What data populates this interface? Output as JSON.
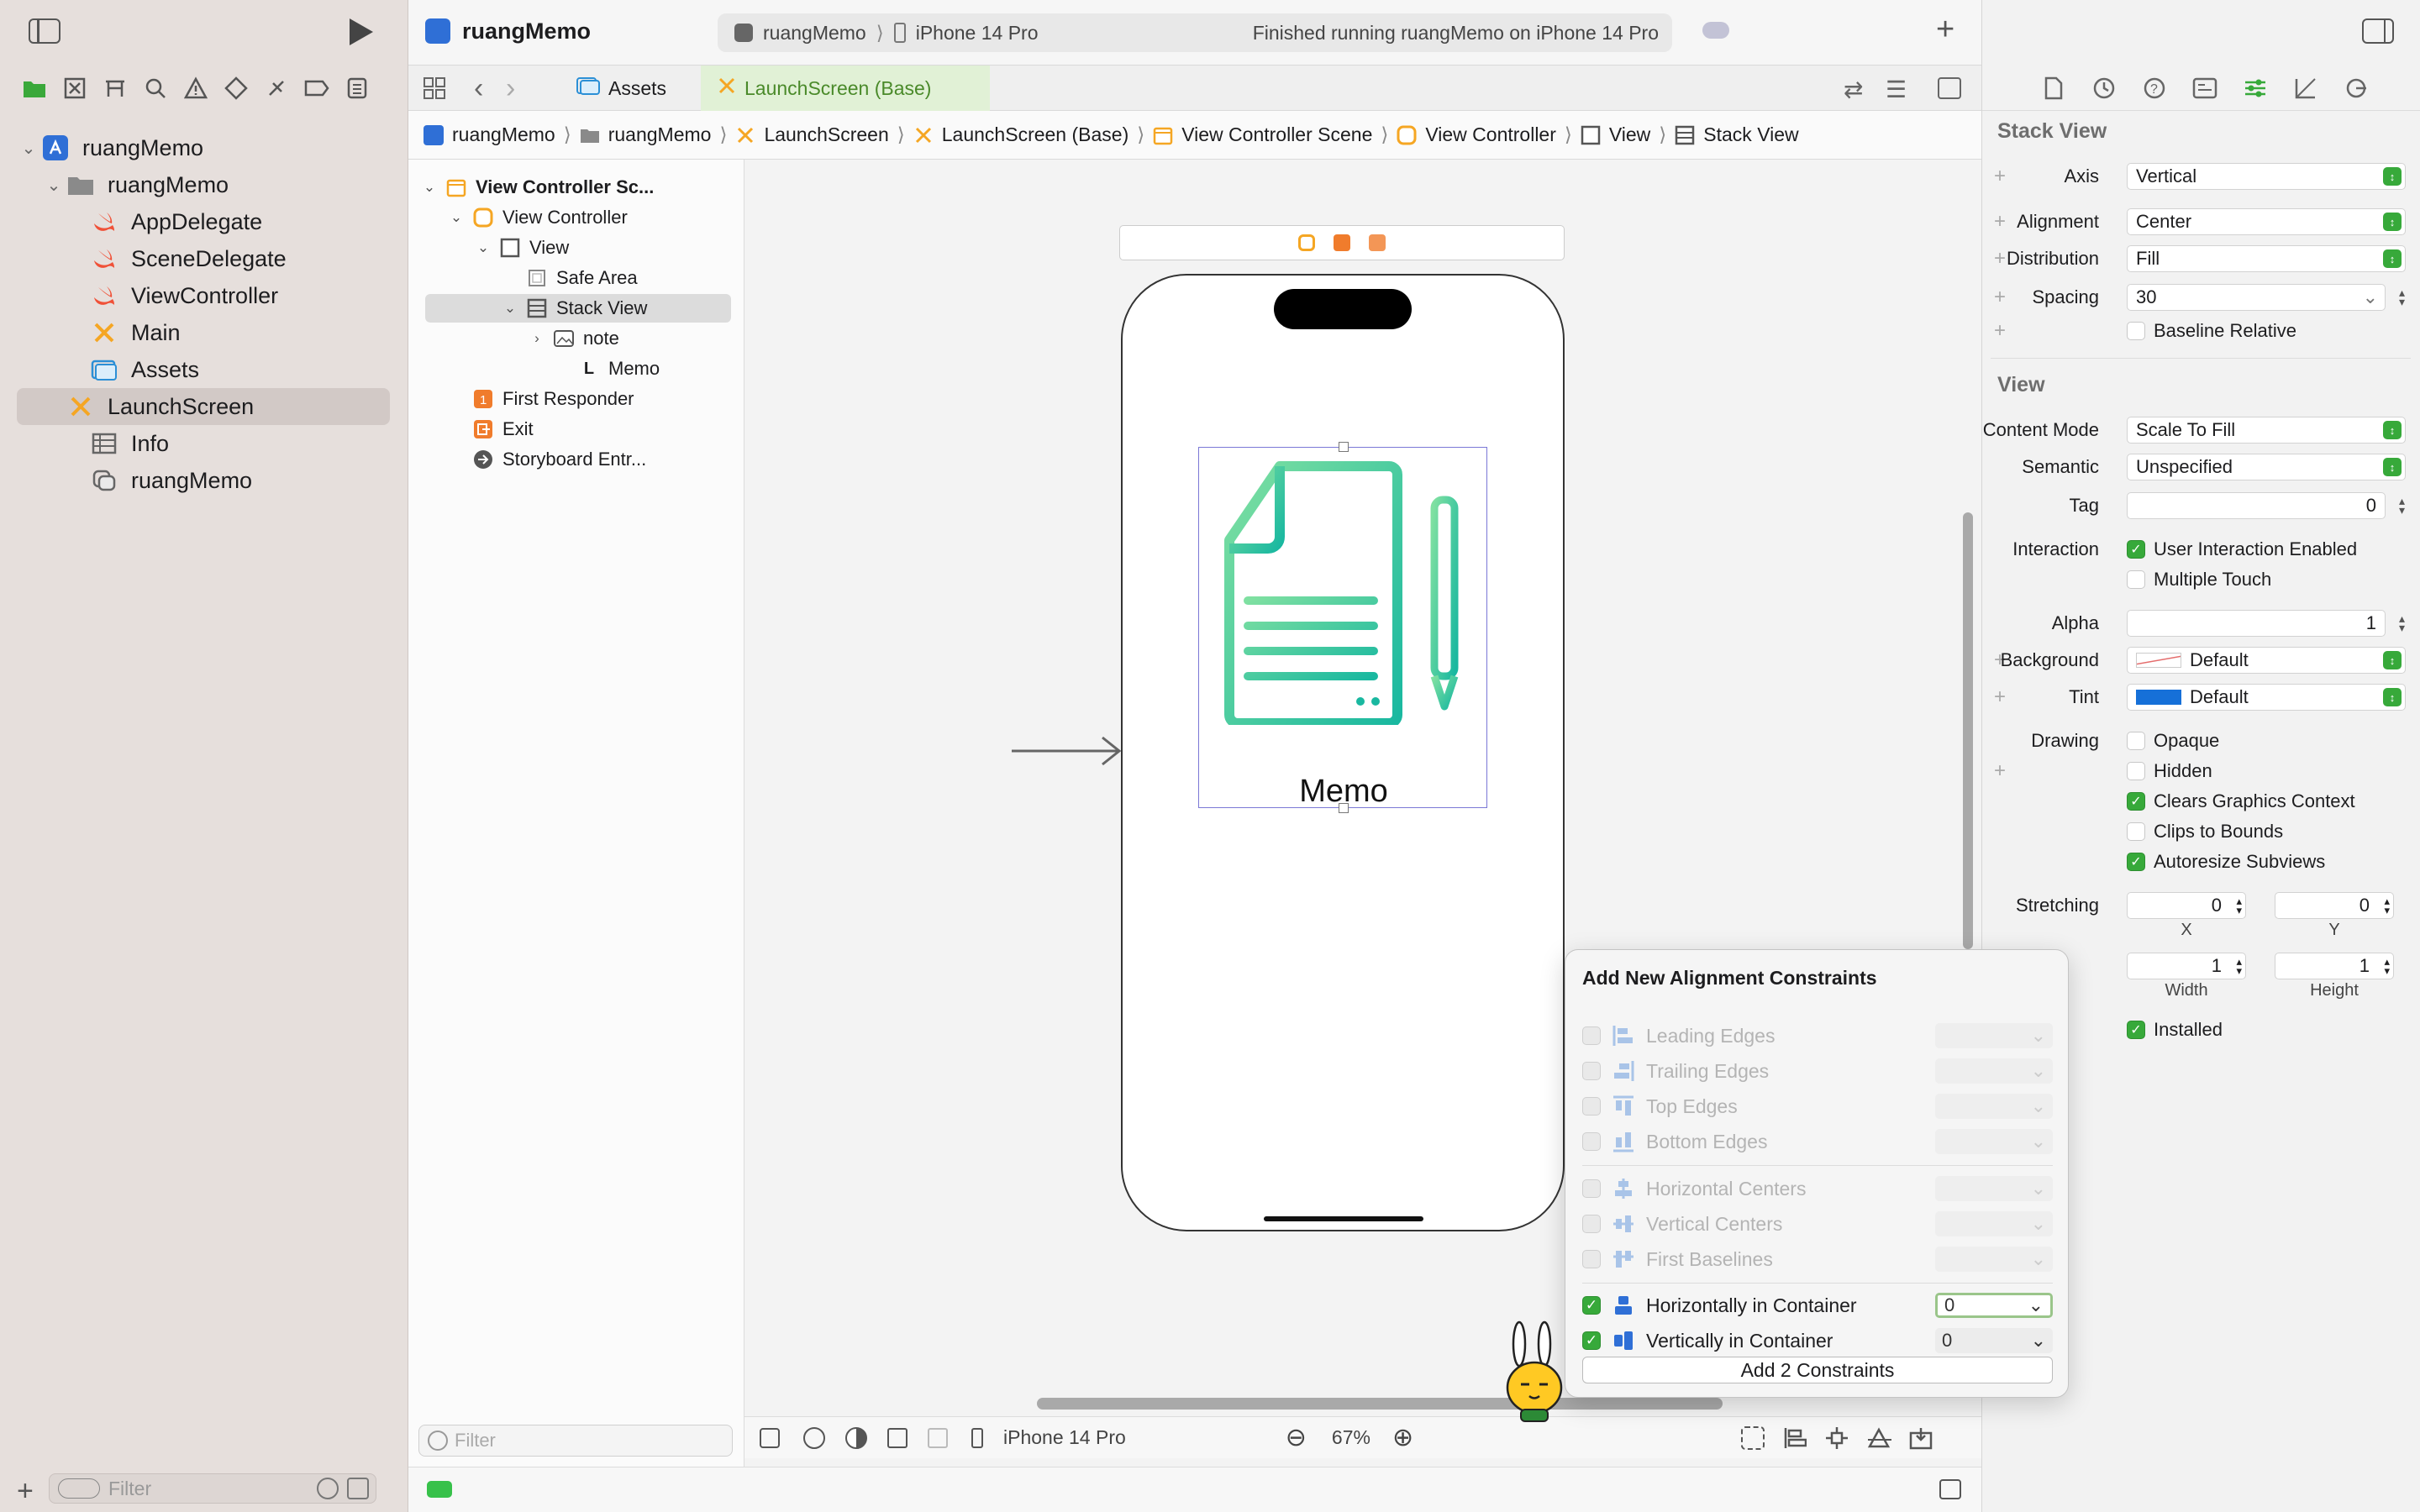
{
  "toolbar": {
    "project_title": "ruangMemo",
    "scheme": "ruangMemo",
    "device": "iPhone 14 Pro",
    "status": "Finished running ruangMemo on iPhone 14 Pro"
  },
  "tabs": [
    {
      "label": "Assets"
    },
    {
      "label": "LaunchScreen (Base)"
    }
  ],
  "navigator": {
    "items": [
      {
        "label": "ruangMemo",
        "icon": "app-project-icon"
      },
      {
        "label": "ruangMemo",
        "icon": "folder-icon"
      },
      {
        "label": "AppDelegate",
        "icon": "swift-file-icon"
      },
      {
        "label": "SceneDelegate",
        "icon": "swift-file-icon"
      },
      {
        "label": "ViewController",
        "icon": "swift-file-icon"
      },
      {
        "label": "Main",
        "icon": "storyboard-icon"
      },
      {
        "label": "Assets",
        "icon": "assets-icon"
      },
      {
        "label": "LaunchScreen",
        "icon": "storyboard-icon"
      },
      {
        "label": "Info",
        "icon": "plist-icon"
      },
      {
        "label": "ruangMemo",
        "icon": "entitlements-icon"
      }
    ],
    "filter_placeholder": "Filter"
  },
  "breadcrumb": [
    "ruangMemo",
    "ruangMemo",
    "LaunchScreen",
    "LaunchScreen (Base)",
    "View Controller Scene",
    "View Controller",
    "View",
    "Stack View"
  ],
  "outline": {
    "items": [
      {
        "label": "View Controller Sc..."
      },
      {
        "label": "View Controller"
      },
      {
        "label": "View"
      },
      {
        "label": "Safe Area"
      },
      {
        "label": "Stack View"
      },
      {
        "label": "note"
      },
      {
        "label": "Memo"
      },
      {
        "label": "First Responder"
      },
      {
        "label": "Exit"
      },
      {
        "label": "Storyboard Entr..."
      }
    ],
    "filter_placeholder": "Filter"
  },
  "canvas": {
    "memo_label": "Memo",
    "device": "iPhone 14 Pro",
    "zoom": "67%"
  },
  "popover": {
    "title": "Add New Alignment Constraints",
    "rows": [
      {
        "label": "Leading Edges",
        "checked": false,
        "value": ""
      },
      {
        "label": "Trailing Edges",
        "checked": false,
        "value": ""
      },
      {
        "label": "Top Edges",
        "checked": false,
        "value": ""
      },
      {
        "label": "Bottom Edges",
        "checked": false,
        "value": ""
      },
      {
        "label": "Horizontal Centers",
        "checked": false,
        "value": ""
      },
      {
        "label": "Vertical Centers",
        "checked": false,
        "value": ""
      },
      {
        "label": "First Baselines",
        "checked": false,
        "value": ""
      },
      {
        "label": "Horizontally in Container",
        "checked": true,
        "value": "0"
      },
      {
        "label": "Vertically in Container",
        "checked": true,
        "value": "0"
      }
    ],
    "add_button": "Add 2 Constraints"
  },
  "inspector": {
    "stack_view_header": "Stack View",
    "axis": {
      "label": "Axis",
      "value": "Vertical"
    },
    "alignment": {
      "label": "Alignment",
      "value": "Center"
    },
    "distribution": {
      "label": "Distribution",
      "value": "Fill"
    },
    "spacing": {
      "label": "Spacing",
      "value": "30"
    },
    "baseline_relative": "Baseline Relative",
    "view_header": "View",
    "content_mode": {
      "label": "Content Mode",
      "value": "Scale To Fill"
    },
    "semantic": {
      "label": "Semantic",
      "value": "Unspecified"
    },
    "tag": {
      "label": "Tag",
      "value": "0"
    },
    "interaction": {
      "label": "Interaction",
      "option1": "User Interaction Enabled",
      "option2": "Multiple Touch"
    },
    "alpha": {
      "label": "Alpha",
      "value": "1"
    },
    "background": {
      "label": "Background",
      "value": "Default"
    },
    "tint": {
      "label": "Tint",
      "value": "Default",
      "color": "#1670d8"
    },
    "drawing": {
      "label": "Drawing",
      "opaque": "Opaque",
      "hidden": "Hidden",
      "clears": "Clears Graphics Context",
      "clips": "Clips to Bounds",
      "autoresize": "Autoresize Subviews"
    },
    "stretching": {
      "label": "Stretching",
      "x": "0",
      "y": "0",
      "x_label": "X",
      "y_label": "Y",
      "width": "1",
      "height": "1",
      "width_label": "Width",
      "height_label": "Height"
    },
    "installed": "Installed"
  },
  "colors": {
    "accent": "#37a93a",
    "swift": "#f05138",
    "storyboard": "#f5a623",
    "selection": "#7b78d6"
  }
}
